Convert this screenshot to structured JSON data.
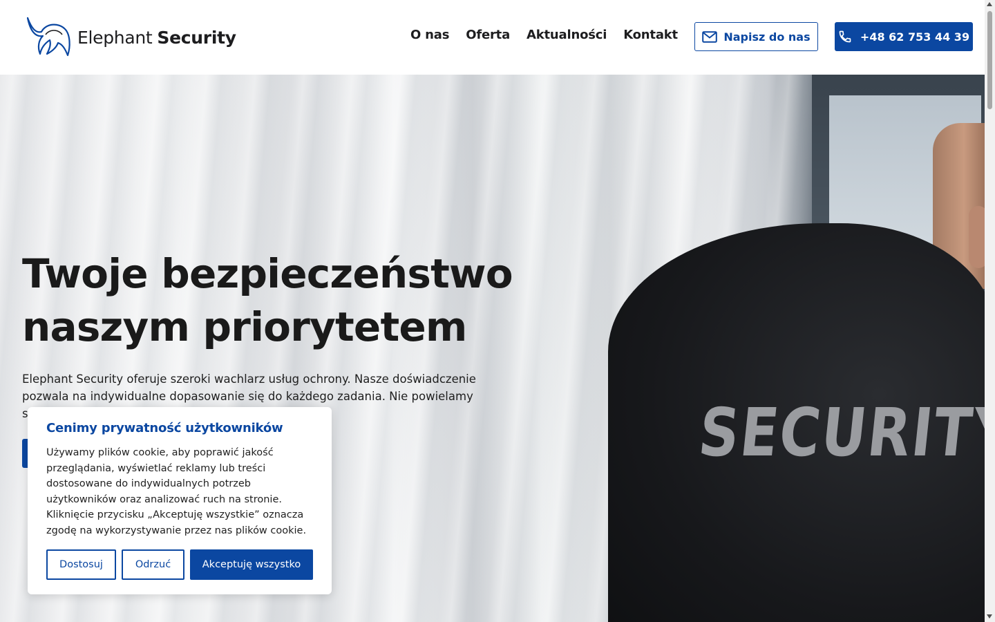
{
  "header": {
    "logo": {
      "icon": "elephant-logo-icon",
      "text_regular": "Elephant",
      "text_bold": "Security"
    },
    "nav": [
      {
        "label": "O nas"
      },
      {
        "label": "Oferta"
      },
      {
        "label": "Aktualności"
      },
      {
        "label": "Kontakt"
      }
    ],
    "write_button": {
      "label": "Napisz do nas",
      "icon": "mail-icon"
    },
    "phone_button": {
      "label": "+48 62 753 44 39",
      "icon": "phone-icon"
    }
  },
  "hero": {
    "title_line1": "Twoje bezpieczeństwo",
    "title_line2": "naszym priorytetem",
    "description": "Elephant Security oferuje szeroki wachlarz usług ochrony. Nasze doświadczenie pozwala na indywidualne dopasowanie się do każdego zadania. Nie powielamy s",
    "image_print": "SECURITY"
  },
  "cookie_banner": {
    "title": "Cenimy prywatność użytkowników",
    "text": "Używamy plików cookie, aby poprawić jakość przeglądania, wyświetlać reklamy lub treści dostosowane do indywidualnych potrzeb użytkowników oraz analizować ruch na stronie. Kliknięcie przycisku „Akceptuję wszystkie” oznacza zgodę na wykorzystywanie przez nas plików cookie.",
    "buttons": {
      "customize": "Dostosuj",
      "reject": "Odrzuć",
      "accept": "Akceptuję wszystko"
    }
  },
  "colors": {
    "accent": "#0b47a1",
    "text": "#1a1a1a",
    "background": "#ffffff"
  }
}
